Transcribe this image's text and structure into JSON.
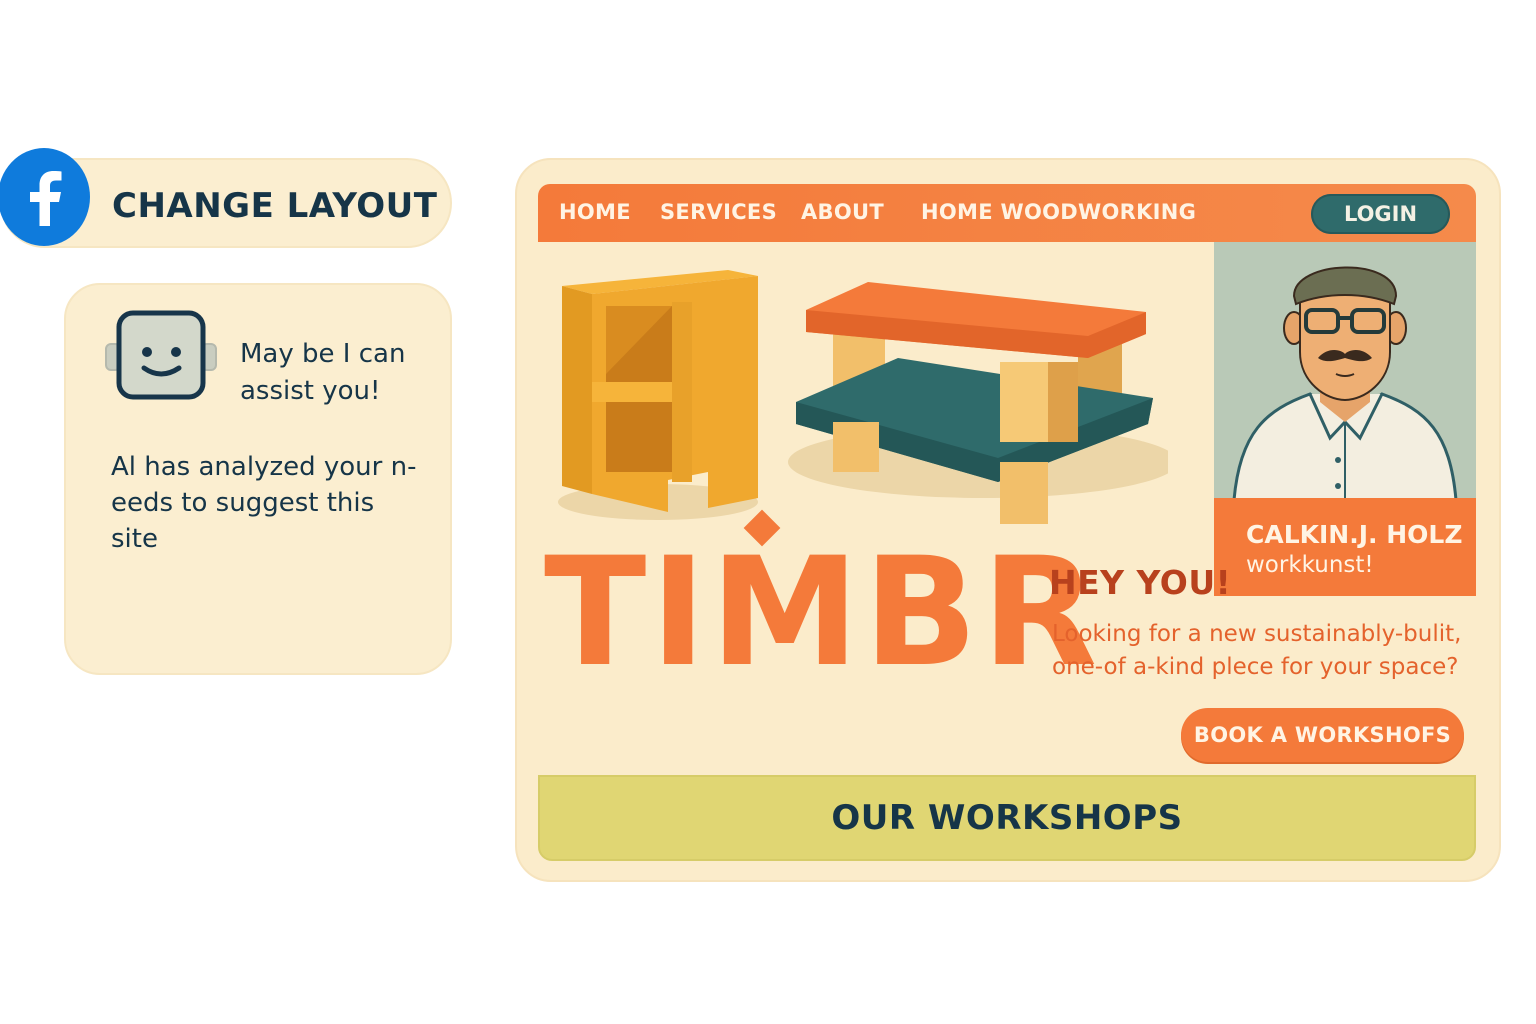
{
  "layout_switcher": {
    "icon": "facebook-icon",
    "label": "CHANGE LAYOUT"
  },
  "assistant": {
    "icon": "robot-face-icon",
    "heading": "May be I can assist you!",
    "message": "Al has analyzed your n-eeds to suggest this site"
  },
  "site": {
    "nav": {
      "items": [
        "HOME",
        "SERVICES",
        "ABOUT",
        "HOME WOODWORKING"
      ],
      "login_label": "LOGIN"
    },
    "hero": {
      "brand": "TIMBR",
      "headline": "HEY YOU!",
      "tagline": "Looking for a new sustainably-bulit, one-of a-kind plece for your space?",
      "cta_label": "BOOK A WORKSHOFS"
    },
    "profile": {
      "name": "CALKIN.J. HOLZ",
      "role": "workkunst!"
    },
    "workshops_title": "OUR WORKSHOPS"
  },
  "colors": {
    "accent_orange": "#f47a3a",
    "teal": "#2f6b6b",
    "cream": "#fbeccb",
    "olive": "#e0d673",
    "navy_text": "#163548",
    "facebook_blue": "#0f7bdc"
  }
}
